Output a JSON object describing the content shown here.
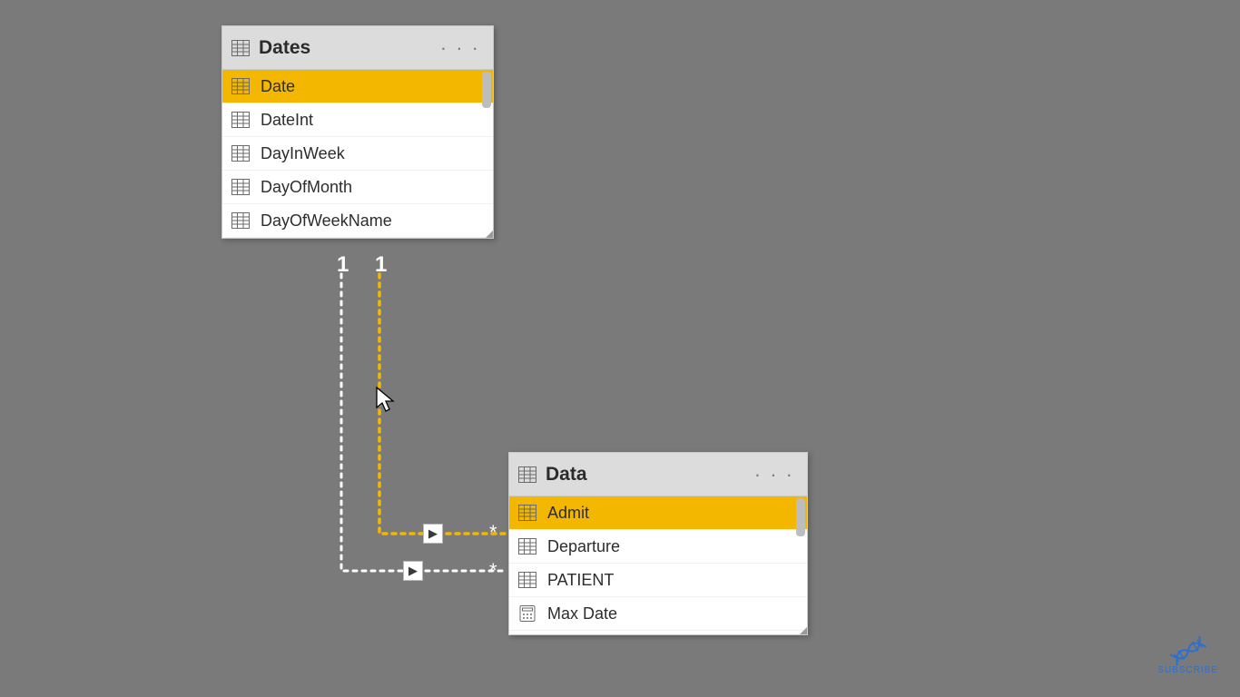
{
  "tables": {
    "dates": {
      "title": "Dates",
      "fields": [
        {
          "name": "Date",
          "icon": "table",
          "selected": true
        },
        {
          "name": "DateInt",
          "icon": "table",
          "selected": false
        },
        {
          "name": "DayInWeek",
          "icon": "table",
          "selected": false
        },
        {
          "name": "DayOfMonth",
          "icon": "table",
          "selected": false
        },
        {
          "name": "DayOfWeekName",
          "icon": "table",
          "selected": false
        }
      ]
    },
    "data": {
      "title": "Data",
      "fields": [
        {
          "name": "Admit",
          "icon": "table",
          "selected": true
        },
        {
          "name": "Departure",
          "icon": "table",
          "selected": false
        },
        {
          "name": "PATIENT",
          "icon": "table",
          "selected": false
        },
        {
          "name": "Max Date",
          "icon": "calc",
          "selected": false
        }
      ]
    }
  },
  "relationships": {
    "active": {
      "from_card": "1",
      "to_card": "*"
    },
    "inactive": {
      "from_card": "1",
      "to_card": "*"
    }
  },
  "watermark": {
    "label": "SUBSCRIBE"
  }
}
